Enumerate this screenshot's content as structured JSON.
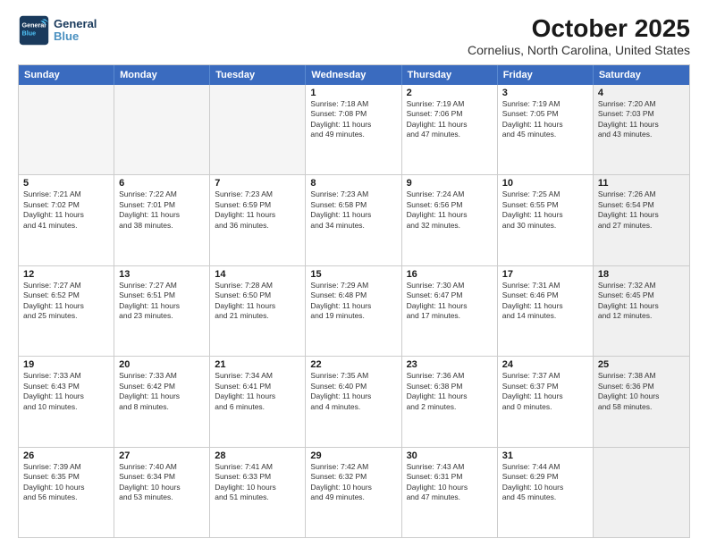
{
  "logo": {
    "line1": "General",
    "line2": "Blue"
  },
  "title": "October 2025",
  "subtitle": "Cornelius, North Carolina, United States",
  "header_days": [
    "Sunday",
    "Monday",
    "Tuesday",
    "Wednesday",
    "Thursday",
    "Friday",
    "Saturday"
  ],
  "weeks": [
    [
      {
        "day": "",
        "text": "",
        "empty": true
      },
      {
        "day": "",
        "text": "",
        "empty": true
      },
      {
        "day": "",
        "text": "",
        "empty": true
      },
      {
        "day": "1",
        "text": "Sunrise: 7:18 AM\nSunset: 7:08 PM\nDaylight: 11 hours\nand 49 minutes."
      },
      {
        "day": "2",
        "text": "Sunrise: 7:19 AM\nSunset: 7:06 PM\nDaylight: 11 hours\nand 47 minutes."
      },
      {
        "day": "3",
        "text": "Sunrise: 7:19 AM\nSunset: 7:05 PM\nDaylight: 11 hours\nand 45 minutes."
      },
      {
        "day": "4",
        "text": "Sunrise: 7:20 AM\nSunset: 7:03 PM\nDaylight: 11 hours\nand 43 minutes.",
        "shaded": true
      }
    ],
    [
      {
        "day": "5",
        "text": "Sunrise: 7:21 AM\nSunset: 7:02 PM\nDaylight: 11 hours\nand 41 minutes."
      },
      {
        "day": "6",
        "text": "Sunrise: 7:22 AM\nSunset: 7:01 PM\nDaylight: 11 hours\nand 38 minutes."
      },
      {
        "day": "7",
        "text": "Sunrise: 7:23 AM\nSunset: 6:59 PM\nDaylight: 11 hours\nand 36 minutes."
      },
      {
        "day": "8",
        "text": "Sunrise: 7:23 AM\nSunset: 6:58 PM\nDaylight: 11 hours\nand 34 minutes."
      },
      {
        "day": "9",
        "text": "Sunrise: 7:24 AM\nSunset: 6:56 PM\nDaylight: 11 hours\nand 32 minutes."
      },
      {
        "day": "10",
        "text": "Sunrise: 7:25 AM\nSunset: 6:55 PM\nDaylight: 11 hours\nand 30 minutes."
      },
      {
        "day": "11",
        "text": "Sunrise: 7:26 AM\nSunset: 6:54 PM\nDaylight: 11 hours\nand 27 minutes.",
        "shaded": true
      }
    ],
    [
      {
        "day": "12",
        "text": "Sunrise: 7:27 AM\nSunset: 6:52 PM\nDaylight: 11 hours\nand 25 minutes."
      },
      {
        "day": "13",
        "text": "Sunrise: 7:27 AM\nSunset: 6:51 PM\nDaylight: 11 hours\nand 23 minutes."
      },
      {
        "day": "14",
        "text": "Sunrise: 7:28 AM\nSunset: 6:50 PM\nDaylight: 11 hours\nand 21 minutes."
      },
      {
        "day": "15",
        "text": "Sunrise: 7:29 AM\nSunset: 6:48 PM\nDaylight: 11 hours\nand 19 minutes."
      },
      {
        "day": "16",
        "text": "Sunrise: 7:30 AM\nSunset: 6:47 PM\nDaylight: 11 hours\nand 17 minutes."
      },
      {
        "day": "17",
        "text": "Sunrise: 7:31 AM\nSunset: 6:46 PM\nDaylight: 11 hours\nand 14 minutes."
      },
      {
        "day": "18",
        "text": "Sunrise: 7:32 AM\nSunset: 6:45 PM\nDaylight: 11 hours\nand 12 minutes.",
        "shaded": true
      }
    ],
    [
      {
        "day": "19",
        "text": "Sunrise: 7:33 AM\nSunset: 6:43 PM\nDaylight: 11 hours\nand 10 minutes."
      },
      {
        "day": "20",
        "text": "Sunrise: 7:33 AM\nSunset: 6:42 PM\nDaylight: 11 hours\nand 8 minutes."
      },
      {
        "day": "21",
        "text": "Sunrise: 7:34 AM\nSunset: 6:41 PM\nDaylight: 11 hours\nand 6 minutes."
      },
      {
        "day": "22",
        "text": "Sunrise: 7:35 AM\nSunset: 6:40 PM\nDaylight: 11 hours\nand 4 minutes."
      },
      {
        "day": "23",
        "text": "Sunrise: 7:36 AM\nSunset: 6:38 PM\nDaylight: 11 hours\nand 2 minutes."
      },
      {
        "day": "24",
        "text": "Sunrise: 7:37 AM\nSunset: 6:37 PM\nDaylight: 11 hours\nand 0 minutes."
      },
      {
        "day": "25",
        "text": "Sunrise: 7:38 AM\nSunset: 6:36 PM\nDaylight: 10 hours\nand 58 minutes.",
        "shaded": true
      }
    ],
    [
      {
        "day": "26",
        "text": "Sunrise: 7:39 AM\nSunset: 6:35 PM\nDaylight: 10 hours\nand 56 minutes."
      },
      {
        "day": "27",
        "text": "Sunrise: 7:40 AM\nSunset: 6:34 PM\nDaylight: 10 hours\nand 53 minutes."
      },
      {
        "day": "28",
        "text": "Sunrise: 7:41 AM\nSunset: 6:33 PM\nDaylight: 10 hours\nand 51 minutes."
      },
      {
        "day": "29",
        "text": "Sunrise: 7:42 AM\nSunset: 6:32 PM\nDaylight: 10 hours\nand 49 minutes."
      },
      {
        "day": "30",
        "text": "Sunrise: 7:43 AM\nSunset: 6:31 PM\nDaylight: 10 hours\nand 47 minutes."
      },
      {
        "day": "31",
        "text": "Sunrise: 7:44 AM\nSunset: 6:29 PM\nDaylight: 10 hours\nand 45 minutes."
      },
      {
        "day": "",
        "text": "",
        "empty": true,
        "shaded": true
      }
    ]
  ]
}
